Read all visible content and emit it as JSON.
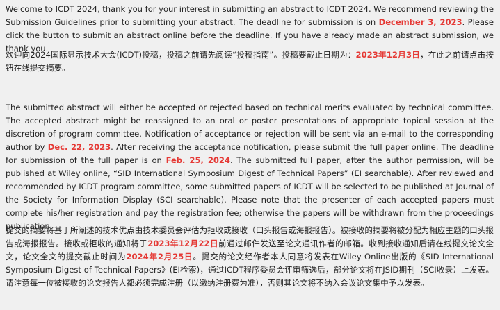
{
  "intro_en": {
    "before": "Welcome to ICDT 2024, thank you for your interest in submitting an abstract to ICDT 2024. We recommend reviewing the Submission Guidelines prior to submitting your abstract. The deadline for submission is on ",
    "deadline": "December 3, 2023",
    "after": ".  Please click the button to submit an abstract online before the deadline.  If you have already made an abstract submission, we thank you."
  },
  "intro_zh": {
    "before": "欢迎向2024国际显示技术大会(ICDT)投稿，投稿之前请先阅读“投稿指南”。投稿要截止日期为：",
    "deadline": "2023年12月3日",
    "after": "，在此之前请点击按钮在线提交摘要。"
  },
  "review_en": {
    "part1": "The submitted abstract will either be accepted or rejected based on technical merits evaluated by technical committee. The accepted abstract might be reassigned to an oral or poster presentations of appropriate topical session at the discretion of program committee. Notification of acceptance or rejection will be sent via an e-mail to the corresponding author by ",
    "date1": "Dec. 22, 2023",
    "part2": ". After receiving the acceptance notification, please submit the full paper online. The deadline for submission of the full paper is on ",
    "date2": "Feb. 25, 2024",
    "part3": ". The submitted full paper, after the author permission, will be published at Wiley online, “SID International Symposium Digest of Technical Papers” (EI searchable). After reviewed and recommended by ICDT program committee, some submitted papers of ICDT will be selected to be published at Journal of the Society for Information Display (SCI searchable). Please note that the presenter of each accepted papers must complete his/her registration and pay the registration fee; otherwise the papers will be withdrawn from the proceedings publication."
  },
  "review_zh": {
    "part1": "提交的摘要将基于所阐述的技术优点由技术委员会评估为拒收或接收（口头报告或海报报告）。被接收的摘要将被分配为相应主题的口头报告或海报报告。接收或拒收的通知将于",
    "date1": "2023年12月22日",
    "part2": "前通过邮件发送至论文通讯作者的邮箱。收到接收通知后请在线提交论文全文，论文全文的提交截止时间为",
    "date2": "2024年2月25日",
    "part3": "。提交的论文经作者本人同意将发表在Wiley Online出版的《SID International Symposium Digest of Technical Papers》(EI检索)，通过ICDT程序委员会评审筛选后，部分论文将在JSID期刊（SCI收录）上发表。请注意每一位被接收的论文报告人都必须完成注册（以缴纳注册费为准），否则其论文将不纳入会议论文集中予以发表。"
  },
  "colors": {
    "highlight": "#e53935",
    "text": "#222222",
    "background": "#f0f0f0"
  }
}
